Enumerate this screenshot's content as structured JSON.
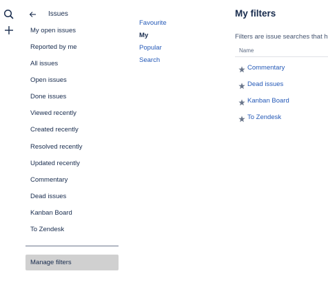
{
  "global_nav": {
    "icons": [
      "search-icon",
      "plus-icon"
    ]
  },
  "sidebar": {
    "title": "Issues",
    "items": [
      {
        "label": "My open issues"
      },
      {
        "label": "Reported by me"
      },
      {
        "label": "All issues"
      },
      {
        "label": "Open issues"
      },
      {
        "label": "Done issues"
      },
      {
        "label": "Viewed recently"
      },
      {
        "label": "Created recently"
      },
      {
        "label": "Resolved recently"
      },
      {
        "label": "Updated recently"
      },
      {
        "label": "Commentary"
      },
      {
        "label": "Dead issues"
      },
      {
        "label": "Kanban Board"
      },
      {
        "label": "To Zendesk"
      }
    ],
    "manage_label": "Manage filters"
  },
  "subnav": {
    "items": [
      {
        "label": "Favourite",
        "active": false
      },
      {
        "label": "My",
        "active": true
      },
      {
        "label": "Popular",
        "active": false
      },
      {
        "label": "Search",
        "active": false
      }
    ]
  },
  "main": {
    "title": "My filters",
    "description": "Filters are issue searches that hav",
    "table": {
      "header_name": "Name",
      "rows": [
        {
          "name": "Commentary",
          "starred": true
        },
        {
          "name": "Dead issues",
          "starred": true
        },
        {
          "name": "Kanban Board",
          "starred": true
        },
        {
          "name": "To Zendesk",
          "starred": true
        }
      ]
    }
  },
  "colors": {
    "link": "#2459b7",
    "text": "#172b4d",
    "star": "#6b778c",
    "manage_bg": "#d0d0d0"
  }
}
